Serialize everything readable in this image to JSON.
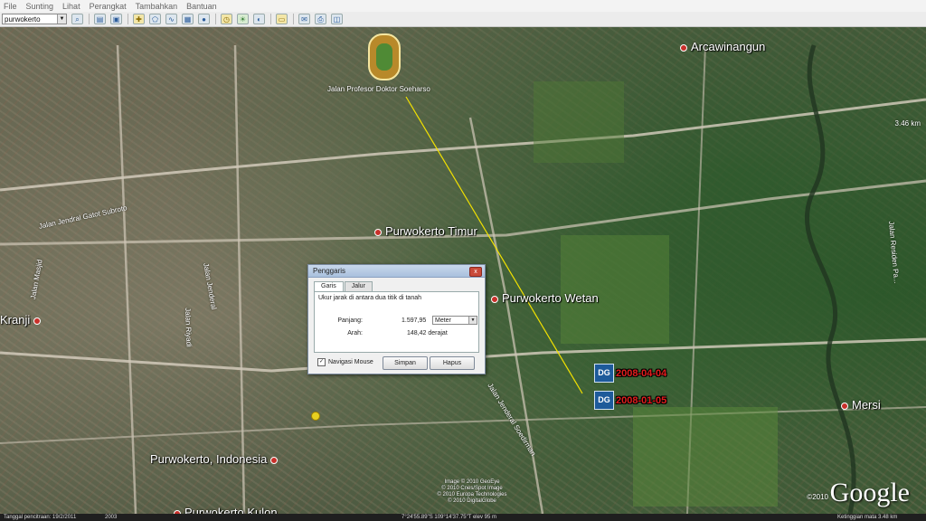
{
  "menu": [
    "File",
    "Sunting",
    "Lihat",
    "Perangkat",
    "Tambahkan",
    "Bantuan"
  ],
  "search": {
    "value": "purwokerto"
  },
  "places": {
    "arcawinangun": "Arcawinangun",
    "purwokerto_timur": "Purwokerto Timur",
    "purwokerto_wetan": "Purwokerto Wetan",
    "kranji": "Kranji",
    "purwokerto_indonesia": "Purwokerto, Indonesia",
    "purwokerto_kulon": "Purwokerto Kulon",
    "mersi": "Mersi"
  },
  "roads": {
    "prof": "Jalan Profesor Doktor Soeharso",
    "gatot": "Jalan Jendral Gatot Subroto",
    "jenderal": "Jalan Jenderal",
    "soedirman": "Jalan Jenderal Soedirman",
    "masjid": "Jalan Masjid",
    "riyadi": "Jalan Riyadi",
    "residen": "Jalan Residen Pa..."
  },
  "imagery_dates": [
    "2008-04-04",
    "2008-01-05"
  ],
  "dg_logo": "DG",
  "dialog": {
    "title": "Penggaris",
    "close_label": "x",
    "tabs": [
      "Garis",
      "Jalur"
    ],
    "description": "Ukur jarak di antara dua titik di tanah",
    "length_label": "Panjang:",
    "length_value": "1.597,95",
    "unit": "Meter",
    "heading_label": "Arah:",
    "heading_value": "148,42 derajat",
    "mouse_nav_label": "Navigasi Mouse",
    "save_label": "Simpan",
    "delete_label": "Hapus"
  },
  "branding": {
    "google": "Google",
    "copyright_year": "©2010"
  },
  "image_copyright": [
    "Image © 2010 GeoEye",
    "© 2010 Cnes/Spot Image",
    "© 2010 Europa Technologies",
    "© 2010 DigitalGlobe"
  ],
  "scale_label": "3.46 km",
  "status": {
    "date": "Tanggal pencitraan: 19/2/2011",
    "year": "2003",
    "coords": "7°24'55.89\"S  109°14'37.75\"T  elev  95 m",
    "eye_alt": "Ketinggian mata  3.48 km"
  },
  "colors": {
    "measure_line": "#f2e100",
    "place_dot": "#c8302a",
    "date_text": "#e21d1d"
  }
}
